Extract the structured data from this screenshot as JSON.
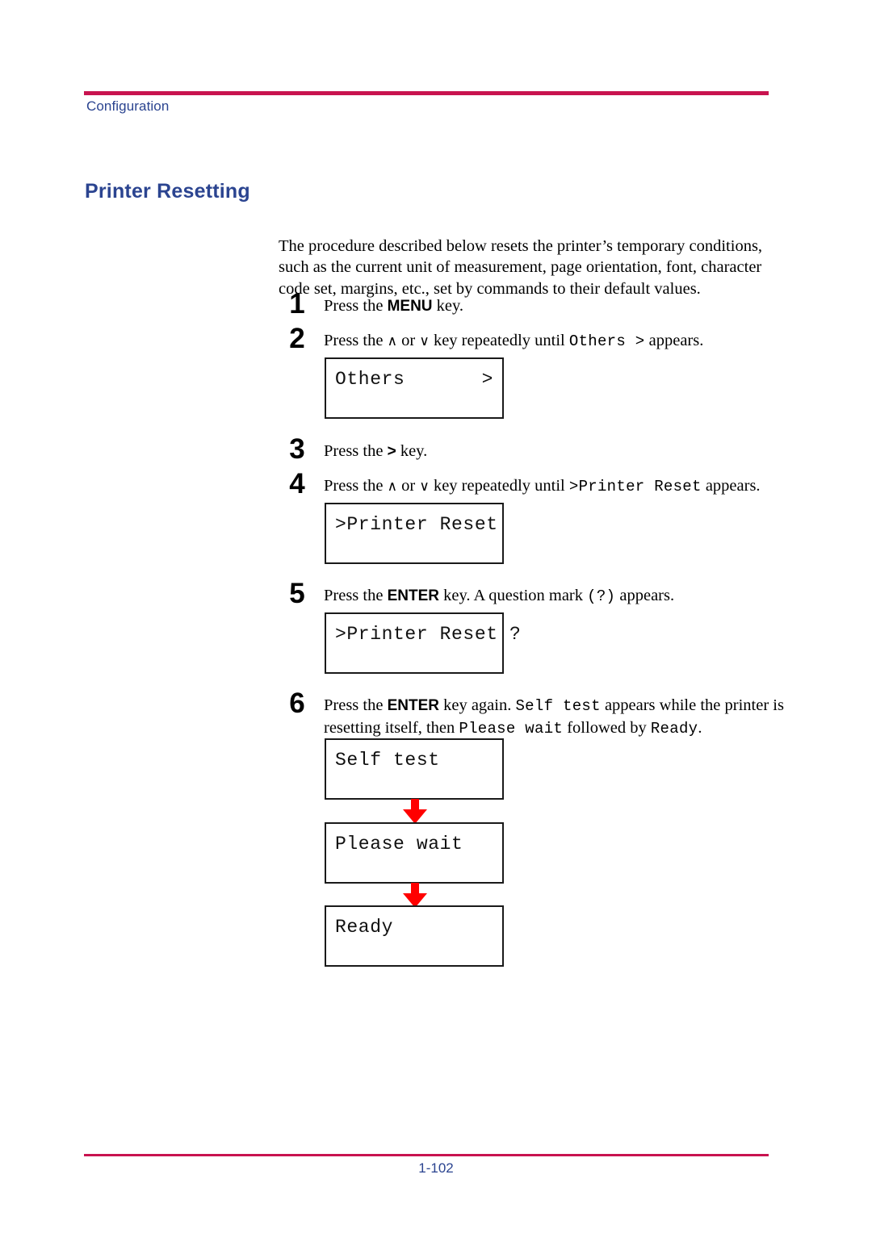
{
  "header": {
    "running_head": "Configuration",
    "rule_color": "#c8134f",
    "text_color": "#2b4490"
  },
  "title": "Printer Resetting",
  "intro": "The procedure described below resets the printer’s temporary conditions, such as the current unit of measurement, page orientation, font, character code set, margins, etc., set by commands to their default values.",
  "steps": [
    {
      "number": "1",
      "prefix": "Press the ",
      "key": "MENU",
      "suffix": " key."
    },
    {
      "number": "2",
      "prefix": "Press the ",
      "up_glyph": "∧",
      "mid": " or ",
      "down_glyph": "∨",
      "middle_text": " key repeatedly until ",
      "mono": "Others  >",
      "suffix": " appears."
    },
    {
      "number": "3",
      "prefix": "Press the ",
      "key": ">",
      "suffix": " key."
    },
    {
      "number": "4",
      "prefix": "Press the ",
      "up_glyph": "∧",
      "mid": " or ",
      "down_glyph": "∨",
      "middle_text": " key repeatedly until ",
      "mono": ">Printer Reset",
      "suffix": " appears."
    },
    {
      "number": "5",
      "prefix": "Press the ",
      "key": "ENTER",
      "mid2": " key. A question mark ",
      "mono": "(?)",
      "suffix": " appears."
    },
    {
      "number": "6",
      "prefix": "Press the ",
      "key": "ENTER",
      "mid2": " key again. ",
      "mono": "Self test",
      "after_mono": " appears while the printer is resetting itself, then ",
      "mono2": "Please wait",
      "after_mono2": " followed by ",
      "mono3": "Ready",
      "suffix": "."
    }
  ],
  "lcd_panels": [
    {
      "left": "Others",
      "right": ">"
    },
    {
      "left": ">Printer Reset",
      "right": ""
    },
    {
      "left": ">Printer Reset ?",
      "right": ""
    },
    {
      "left": "Self test",
      "right": ""
    },
    {
      "left": "Please wait",
      "right": ""
    },
    {
      "left": "Ready",
      "right": ""
    }
  ],
  "arrow_color": "#ff0000",
  "arrow_icon_name": "down-arrow-icon",
  "footer": {
    "page_number": "1-102",
    "rule_color": "#c8134f",
    "text_color": "#2b4490"
  }
}
